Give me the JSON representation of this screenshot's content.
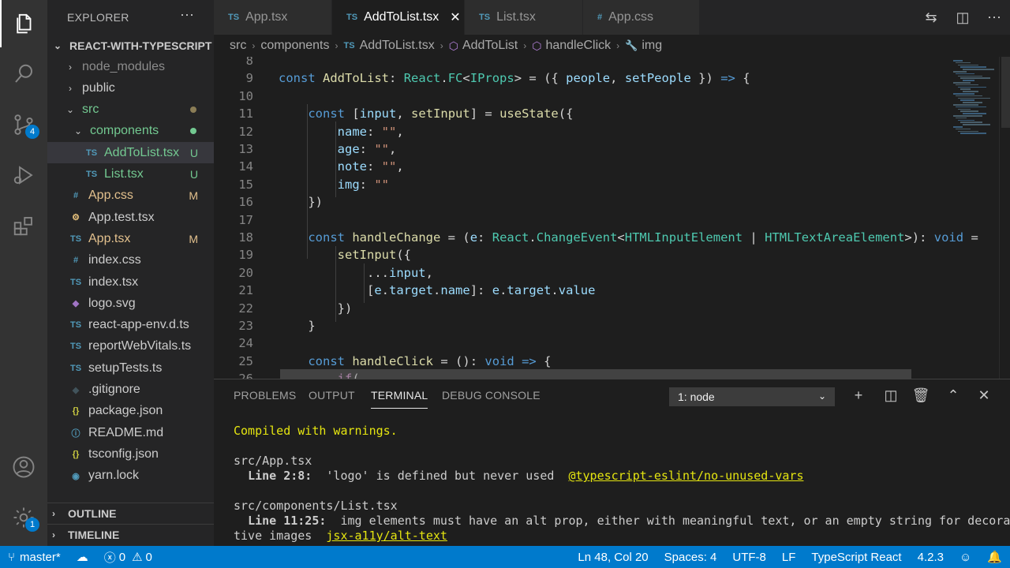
{
  "activity": {
    "scm_badge": "4",
    "settings_badge": "1"
  },
  "explorer": {
    "title": "EXPLORER",
    "more": "···",
    "project": "REACT-WITH-TYPESCRIPT",
    "items": [
      {
        "label": "node_modules",
        "kind": "folder",
        "expanded": false,
        "git": ""
      },
      {
        "label": "public",
        "kind": "folder",
        "expanded": false,
        "git": ""
      },
      {
        "label": "src",
        "kind": "folder",
        "expanded": true,
        "git": "•"
      },
      {
        "label": "components",
        "kind": "folder",
        "expanded": true,
        "git": "•"
      },
      {
        "label": "AddToList.tsx",
        "kind": "ts",
        "git": "U"
      },
      {
        "label": "List.tsx",
        "kind": "ts",
        "git": "U"
      },
      {
        "label": "App.css",
        "kind": "css",
        "git": "M"
      },
      {
        "label": "App.test.tsx",
        "kind": "test",
        "git": ""
      },
      {
        "label": "App.tsx",
        "kind": "ts",
        "git": "M"
      },
      {
        "label": "index.css",
        "kind": "css",
        "git": ""
      },
      {
        "label": "index.tsx",
        "kind": "ts",
        "git": ""
      },
      {
        "label": "logo.svg",
        "kind": "svg",
        "git": ""
      },
      {
        "label": "react-app-env.d.ts",
        "kind": "ts",
        "git": ""
      },
      {
        "label": "reportWebVitals.ts",
        "kind": "ts",
        "git": ""
      },
      {
        "label": "setupTests.ts",
        "kind": "ts",
        "git": ""
      },
      {
        "label": ".gitignore",
        "kind": "git",
        "git": ""
      },
      {
        "label": "package.json",
        "kind": "json",
        "git": ""
      },
      {
        "label": "README.md",
        "kind": "info",
        "git": ""
      },
      {
        "label": "tsconfig.json",
        "kind": "json",
        "git": ""
      },
      {
        "label": "yarn.lock",
        "kind": "yarn",
        "git": ""
      }
    ],
    "outline": "OUTLINE",
    "timeline": "TIMELINE"
  },
  "tabs": [
    {
      "icon": "TS",
      "label": "App.tsx",
      "active": false
    },
    {
      "icon": "TS",
      "label": "AddToList.tsx",
      "active": true
    },
    {
      "icon": "TS",
      "label": "List.tsx",
      "active": false
    },
    {
      "icon": "#",
      "label": "App.css",
      "active": false
    }
  ],
  "breadcrumb": [
    "src",
    "components",
    "AddToList.tsx",
    "AddToList",
    "handleClick",
    "img"
  ],
  "editor": {
    "lines": [
      {
        "n": "8",
        "code": ""
      },
      {
        "n": "9",
        "code": "const AddToList: React.FC<IProps> = ({ people, setPeople }) => {"
      },
      {
        "n": "10",
        "code": ""
      },
      {
        "n": "11",
        "code": "    const [input, setInput] = useState({"
      },
      {
        "n": "12",
        "code": "        name: \"\","
      },
      {
        "n": "13",
        "code": "        age: \"\","
      },
      {
        "n": "14",
        "code": "        note: \"\","
      },
      {
        "n": "15",
        "code": "        img: \"\""
      },
      {
        "n": "16",
        "code": "    })"
      },
      {
        "n": "17",
        "code": ""
      },
      {
        "n": "18",
        "code": "    const handleChange = (e: React.ChangeEvent<HTMLInputElement | HTMLTextAreaElement>): void ="
      },
      {
        "n": "19",
        "code": "        setInput({"
      },
      {
        "n": "20",
        "code": "            ...input,"
      },
      {
        "n": "21",
        "code": "            [e.target.name]: e.target.value"
      },
      {
        "n": "22",
        "code": "        })"
      },
      {
        "n": "23",
        "code": "    }"
      },
      {
        "n": "24",
        "code": ""
      },
      {
        "n": "25",
        "code": "    const handleClick = (): void => {"
      },
      {
        "n": "26",
        "code": "        if("
      }
    ]
  },
  "panel": {
    "tabs": [
      "PROBLEMS",
      "OUTPUT",
      "TERMINAL",
      "DEBUG CONSOLE"
    ],
    "active_tab": "TERMINAL",
    "terminal_select": "1: node",
    "terminal": {
      "compiled": "Compiled with warnings.",
      "file1": "src/App.tsx",
      "w1_loc": "Line 2:8:",
      "w1_msg": "  'logo' is defined but never used  ",
      "w1_rule": "@typescript-eslint/no-unused-vars",
      "file2": "src/components/List.tsx",
      "w2_loc": "Line 11:25:",
      "w2_msg": "  img elements must have an alt prop, either with meaningful text, or an empty string for decora",
      "w2_msg2": "tive images  ",
      "w2_rule": "jsx-a11y/alt-text"
    }
  },
  "status": {
    "branch": "master*",
    "errors": "0",
    "warnings": "0",
    "position": "Ln 48, Col 20",
    "spaces": "Spaces: 4",
    "encoding": "UTF-8",
    "eol": "LF",
    "language": "TypeScript React",
    "version": "4.2.3"
  },
  "colors": {
    "accent": "#007acc",
    "ts_icon": "#519aba",
    "git_untracked": "#73c991",
    "git_modified": "#e2c08d",
    "folder_modified": "#73c991"
  }
}
